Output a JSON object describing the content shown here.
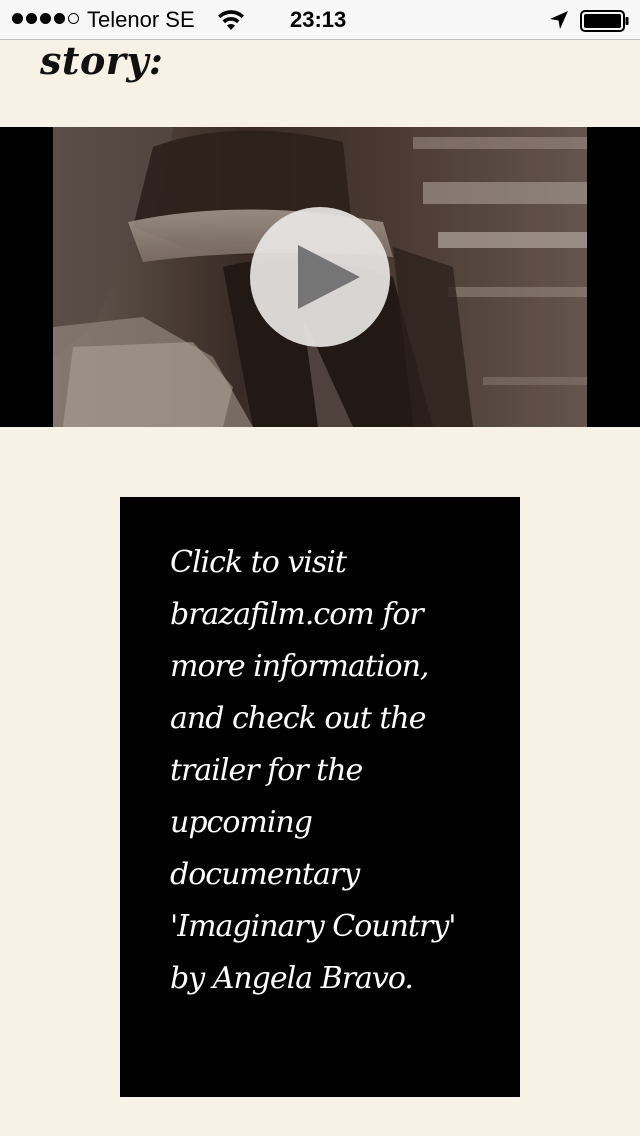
{
  "status_bar": {
    "carrier": "Telenor SE",
    "time": "23:13",
    "signal_bars_filled": 4,
    "signal_bars_total": 5,
    "icons": [
      "signal-icon",
      "wifi-icon",
      "location-arrow-icon",
      "battery-icon"
    ]
  },
  "heading": {
    "text": "story:"
  },
  "video": {
    "play_icon": "play-icon"
  },
  "info_box": {
    "text": "Click to visit brazafilm.com for more information, and check out the trailer for the upcoming documentary 'Imaginary Country' by Angela Bravo."
  },
  "colors": {
    "page_background": "#f8f1e6",
    "status_bar_background": "#f7f7f7",
    "info_box_background": "#000000",
    "info_text": "#ffffff"
  }
}
